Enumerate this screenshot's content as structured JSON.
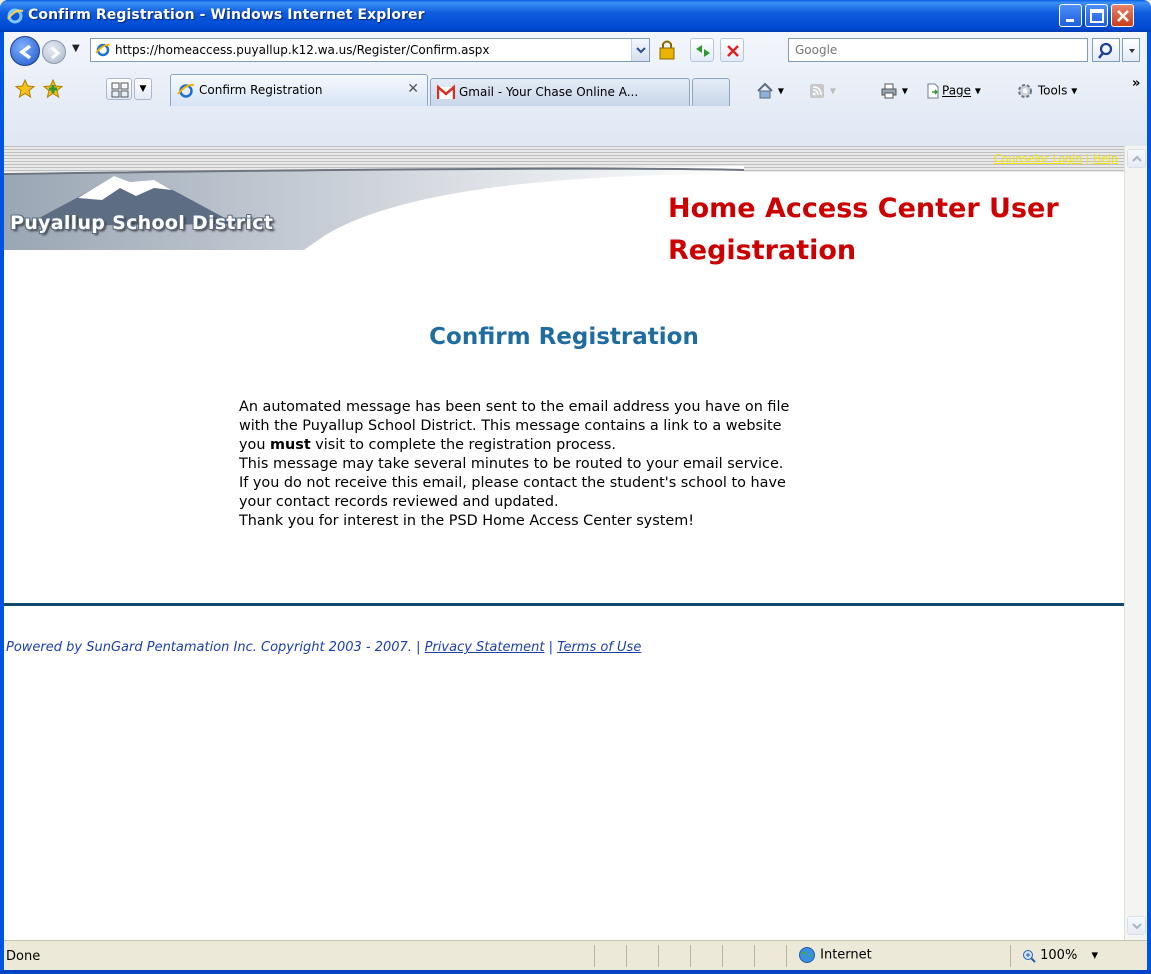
{
  "window": {
    "title": "Confirm Registration - Windows Internet Explorer"
  },
  "toolbar": {
    "url": "https://homeaccess.puyallup.k12.wa.us/Register/Confirm.aspx",
    "search_placeholder": "Google"
  },
  "tabs": [
    {
      "label": "Confirm Registration",
      "active": true
    },
    {
      "label": "Gmail - Your Chase Online A...",
      "active": false
    }
  ],
  "command_bar": {
    "page_label": "Page",
    "tools_label": "Tools"
  },
  "page": {
    "top_links": {
      "counselor": "Counselor Login",
      "separator": "|",
      "help": "Help"
    },
    "district_name": "Puyallup School District",
    "app_title": "Home Access Center User Registration",
    "heading": "Confirm Registration",
    "message": {
      "line1": "An automated message has been sent to the email address you have on file",
      "line2": "with the Puyallup School District.  This message contains a link to a website",
      "line3_pre": "you ",
      "line3_bold": "must",
      "line3_post": " visit to complete the registration process.",
      "line4": "This message may take several minutes to be routed to your email service.",
      "line5": "If you do not receive this email, please contact the student's school to have",
      "line6": "your contact records reviewed and updated.",
      "line7": "Thank you for interest in the PSD Home Access Center system!"
    },
    "footer": {
      "powered": "Powered by SunGard Pentamation Inc. Copyright 2003 - 2007.",
      "sep": "|",
      "privacy": "Privacy Statement",
      "terms": "Terms of Use"
    }
  },
  "status": {
    "text": "Done",
    "zone": "Internet",
    "zoom": "100%"
  },
  "colors": {
    "title_red": "#cc0000",
    "heading_blue": "#1f6da0",
    "footer_blue": "#1d3fa8",
    "link_yellow": "#f3e400"
  },
  "icons": [
    "ie-icon",
    "back-arrow-icon",
    "forward-arrow-icon",
    "lock-icon",
    "refresh-icon",
    "stop-icon",
    "search-icon",
    "favorites-star-icon",
    "add-favorites-icon",
    "quick-tabs-icon",
    "gmail-icon",
    "home-icon",
    "feeds-icon",
    "print-icon",
    "page-icon",
    "tools-gear-icon",
    "globe-icon",
    "zoom-icon"
  ]
}
